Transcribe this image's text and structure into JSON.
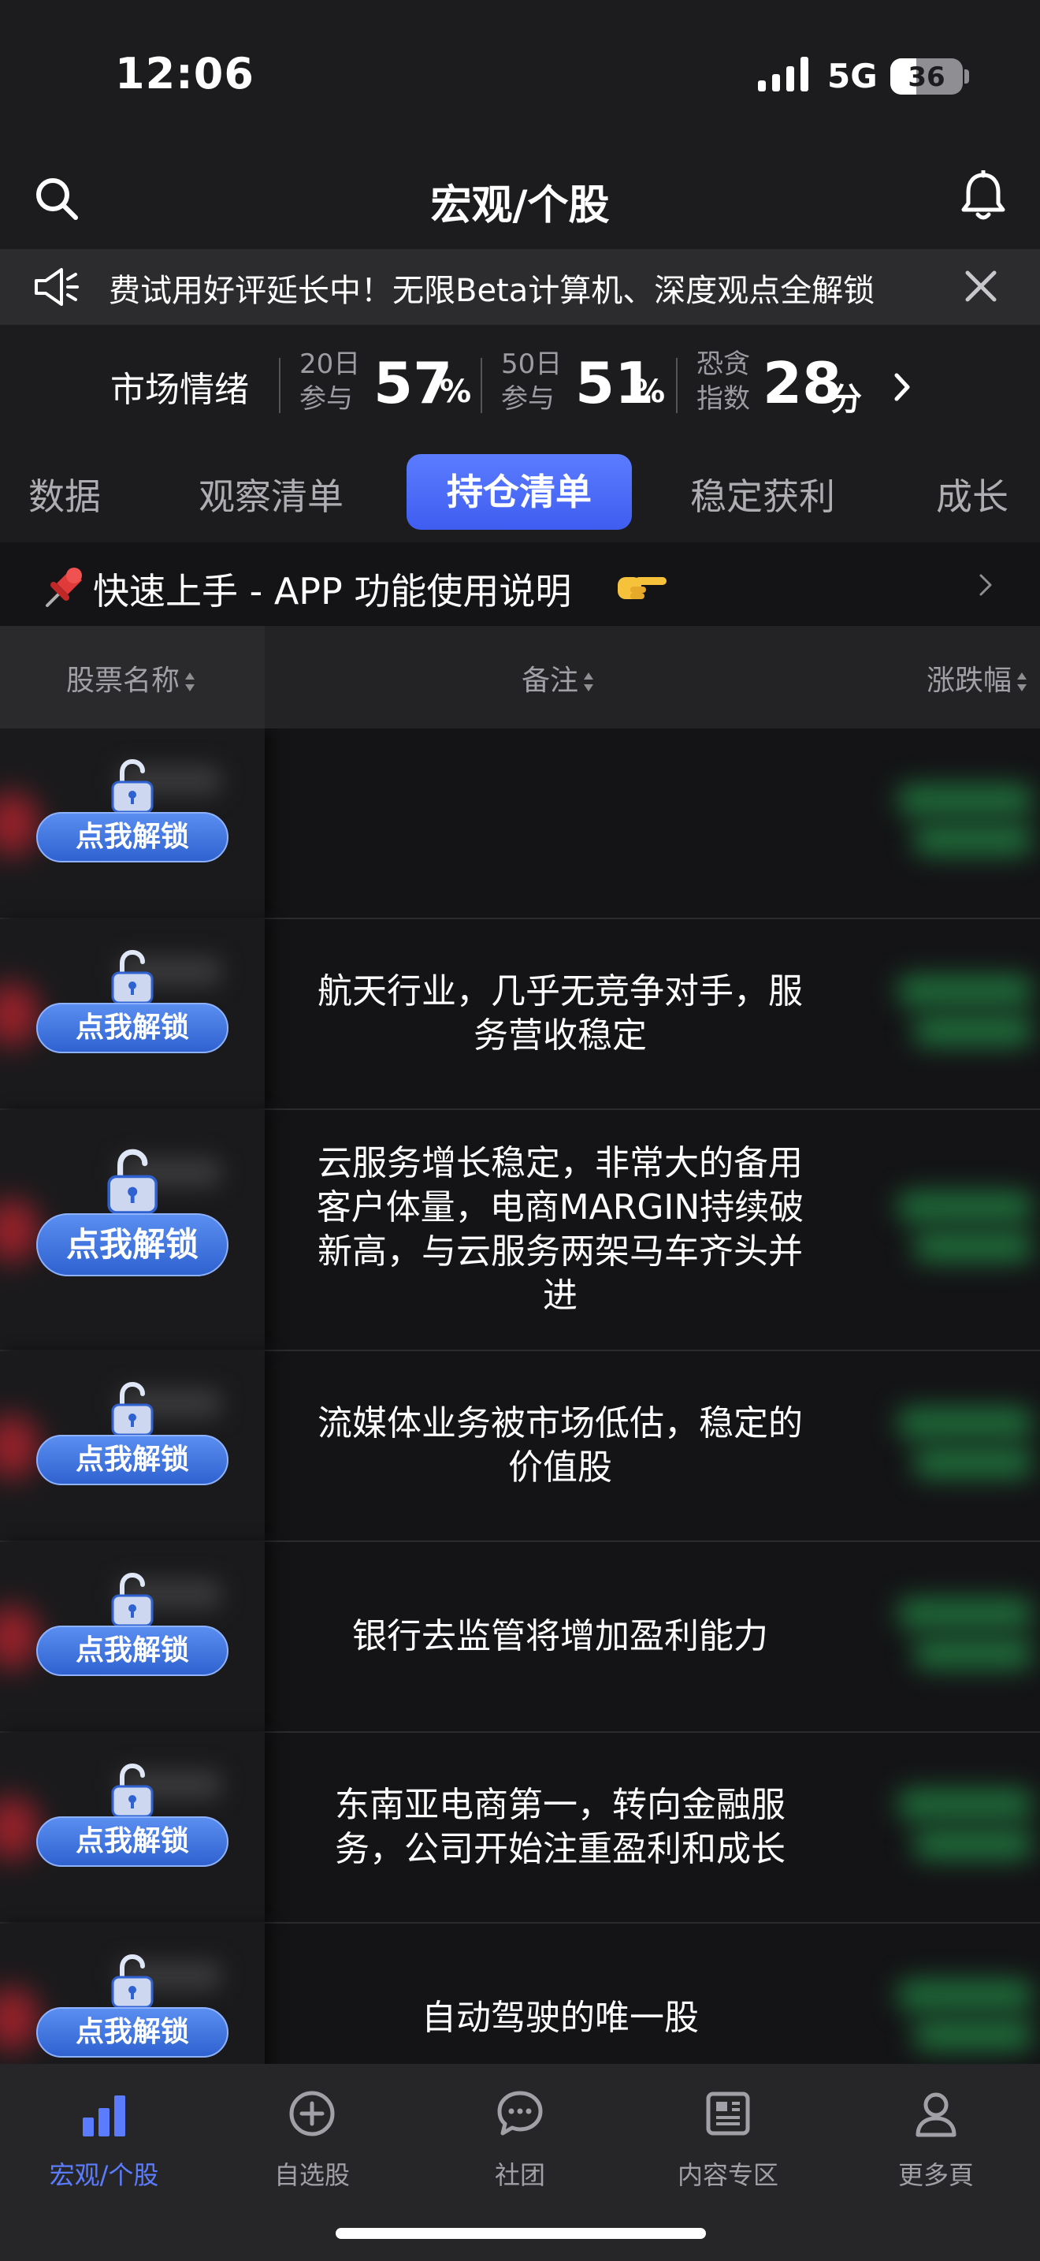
{
  "status_bar": {
    "time": "12:06",
    "network": "5G",
    "battery": "36",
    "battery_level": 0.36
  },
  "header": {
    "title": "宏观/个股"
  },
  "announcement": {
    "text": "费试用好评延长中！无限Beta计算机、深度观点全解锁"
  },
  "sentiment": {
    "label": "市场情绪",
    "d20_top": "20日",
    "d20_bottom": "参与",
    "d20_value": "57",
    "d20_unit": "%",
    "d50_top": "50日",
    "d50_bottom": "参与",
    "d50_value": "51",
    "d50_unit": "%",
    "fear_top": "恐贪",
    "fear_bottom": "指数",
    "fear_value": "28",
    "fear_unit": "分"
  },
  "tabs": [
    {
      "label": "数据"
    },
    {
      "label": "观察清单"
    },
    {
      "label": "持仓清单",
      "active": true
    },
    {
      "label": "稳定获利"
    },
    {
      "label": "成长"
    }
  ],
  "quick_start": {
    "text": "快速上手 - APP 功能使用说明"
  },
  "table": {
    "headers": {
      "name": "股票名称",
      "note": "备注",
      "change": "涨跌幅"
    },
    "unlock_label": "点我解锁",
    "rows": [
      {
        "note_lines": []
      },
      {
        "note_lines": [
          "航天行业，几乎无竞争对手，服",
          "务营收稳定"
        ]
      },
      {
        "note_lines": [
          "云服务增长稳定，非常大的备用",
          "客户体量，电商MARGIN持续破",
          "新高，与云服务两架马车齐头并",
          "进"
        ]
      },
      {
        "note_lines": [
          "流媒体业务被市场低估，稳定的",
          "价值股"
        ]
      },
      {
        "note_lines": [
          "银行去监管将增加盈利能力"
        ]
      },
      {
        "note_lines": [
          "东南亚电商第一，转向金融服",
          "务，公司开始注重盈利和成长"
        ]
      },
      {
        "note_lines": [
          "自动驾驶的唯一股"
        ]
      }
    ]
  },
  "bottom_nav": [
    {
      "label": "宏观/个股",
      "icon": "bar-chart-icon",
      "active": true
    },
    {
      "label": "自选股",
      "icon": "plus-circle-icon"
    },
    {
      "label": "社团",
      "icon": "chat-bubble-icon"
    },
    {
      "label": "内容专区",
      "icon": "news-icon"
    },
    {
      "label": "更多頁",
      "icon": "person-icon"
    }
  ],
  "colors": {
    "accent": "#5b7cff",
    "unlock_button": "#3a6fe0",
    "background": "#1c1c1e"
  }
}
